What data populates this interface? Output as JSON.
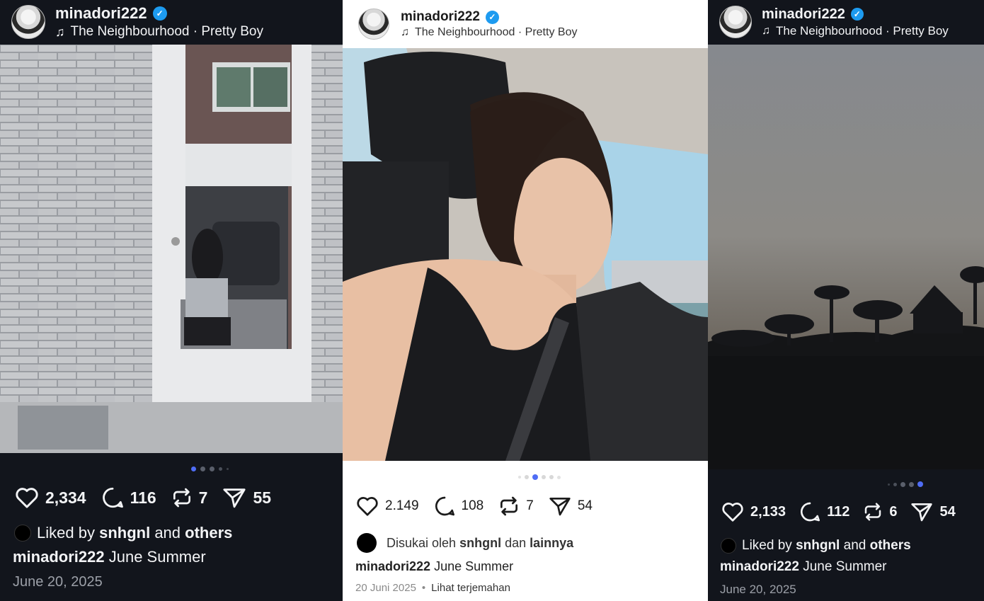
{
  "posts": [
    {
      "username": "minadori222",
      "music": "The Neighbourhood · Pretty Boy",
      "likes": "2,334",
      "comments": "116",
      "reposts": "7",
      "shares": "55",
      "liked_prefix": "Liked by",
      "liked_user": "snhgnl",
      "liked_mid": "and",
      "liked_suffix": "others",
      "caption_user": "minadori222",
      "caption_text": "June Summer",
      "date": "June 20, 2025"
    },
    {
      "username": "minadori222",
      "music": "The Neighbourhood · Pretty Boy",
      "likes": "2.149",
      "comments": "108",
      "reposts": "7",
      "shares": "54",
      "liked_prefix": "Disukai oleh",
      "liked_user": "snhgnl",
      "liked_mid": "dan",
      "liked_suffix": "lainnya",
      "caption_user": "minadori222",
      "caption_text": "June Summer",
      "date": "20 Juni 2025",
      "date_sep": "•",
      "translate": "Lihat terjemahan"
    },
    {
      "username": "minadori222",
      "music": "The Neighbourhood · Pretty Boy",
      "likes": "2,133",
      "comments": "112",
      "reposts": "6",
      "shares": "54",
      "liked_prefix": "Liked by",
      "liked_user": "snhgnl",
      "liked_mid": "and",
      "liked_suffix": "others",
      "caption_user": "minadori222",
      "caption_text": "June Summer",
      "date": "June 20, 2025"
    }
  ],
  "carousel": [
    {
      "count": 5,
      "active": 0
    },
    {
      "count": 6,
      "active": 2
    },
    {
      "count": 5,
      "active": 4
    }
  ],
  "colors": {
    "verified": "#1d9bf0",
    "dot_active": "#4f6df5",
    "dark_bg": "#12151c"
  },
  "icons": [
    "heart-icon",
    "comment-icon",
    "repost-icon",
    "share-icon",
    "music-note-icon",
    "verified-icon"
  ]
}
